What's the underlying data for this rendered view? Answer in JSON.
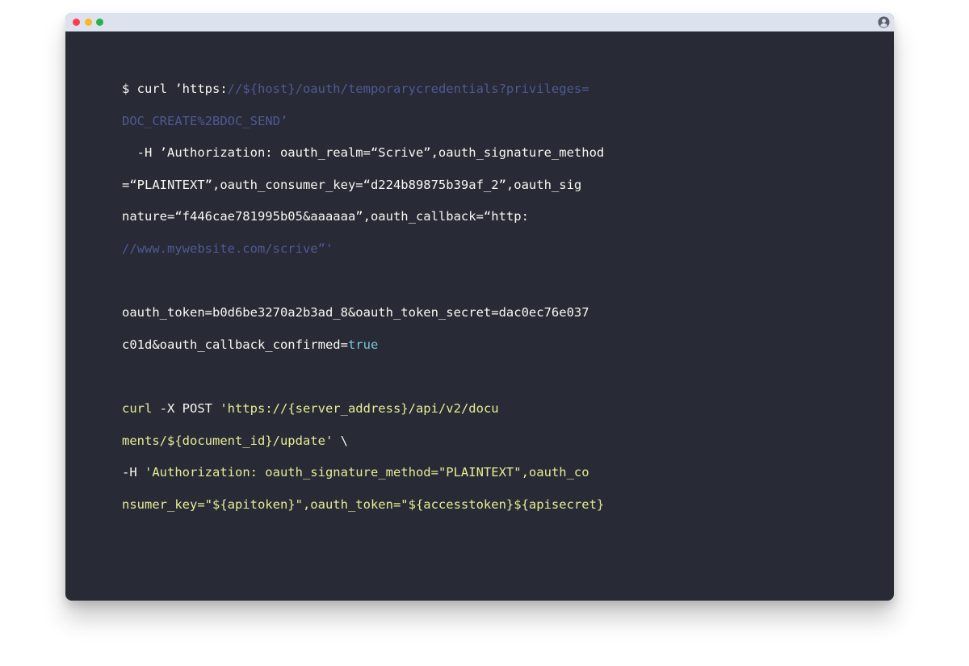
{
  "window": {
    "traffic_lights": [
      {
        "name": "close",
        "color": "#ff3b4b"
      },
      {
        "name": "minimize",
        "color": "#fab821"
      },
      {
        "name": "zoom",
        "color": "#28b249"
      }
    ],
    "user_icon": "user-circle-icon"
  },
  "colors": {
    "background": "#282a36",
    "titlebar": "#dde2ef",
    "text": "#f8f8f2",
    "muted": "#4e5a95",
    "cyan": "#79c7cf",
    "yellow": "#e6ed93"
  },
  "code": {
    "l1_a": "$ curl ’https:",
    "l1_b": "//${host}/oauth/temporarycredentials?privileges=",
    "l2": "DOC_CREATE%2BDOC_SEND’",
    "l3": "  -H ’Authorization: oauth_realm=“Scrive”,oauth_signature_method",
    "l4": "=“PLAINTEXT”,oauth_consumer_key=“d224b89875b39af_2”,oauth_sig",
    "l5": "nature=“f446cae781995b05&aaaaaa”,oauth_callback=“http:",
    "l6": "//www.mywebsite.com/scrive”'",
    "l7": "",
    "l8": "oauth_token=b0d6be3270a2b3ad_8&oauth_token_secret=dac0ec76e037",
    "l9_a": "c01d&oauth_callback_confirmed=",
    "l9_b": "true",
    "l10": "",
    "l11_a": "curl",
    "l11_b": " -X POST ",
    "l11_c": "'https://{server_address}/api/v2/docu",
    "l12_a": "ments/${document_id}/update'",
    "l12_b": " \\",
    "l13_a": "-H ",
    "l13_b": "'Authorization: oauth_signature_method=\"PLAINTEXT\",oauth_co",
    "l14": "nsumer_key=\"${apitoken}\",oauth_token=\"${accesstoken}${apisecret}"
  }
}
